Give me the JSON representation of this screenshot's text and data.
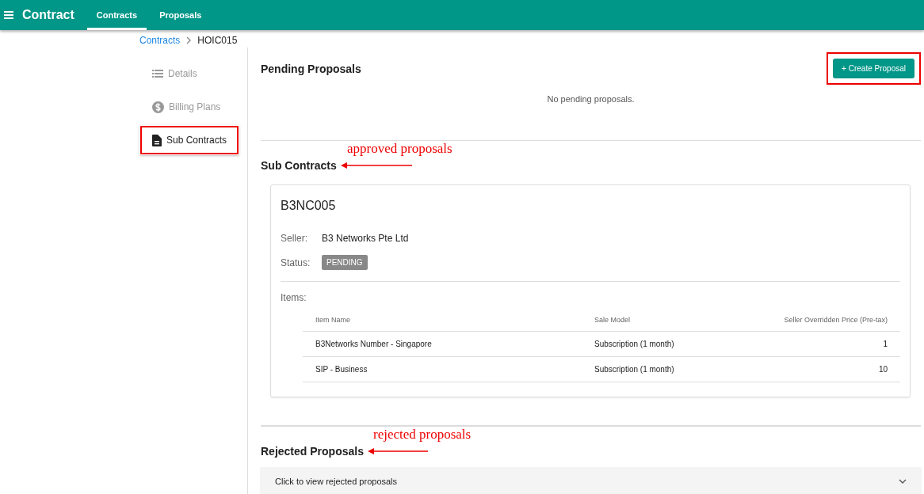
{
  "app_bar": {
    "title": "Contract",
    "tabs": [
      {
        "label": "Contracts",
        "selected": true
      },
      {
        "label": "Proposals",
        "selected": false
      }
    ]
  },
  "breadcrumb": {
    "link": "Contracts",
    "current": "HOIC015"
  },
  "sidebar": {
    "items": [
      {
        "label": "Details",
        "kind": "list",
        "selected": false,
        "highlighted": false
      },
      {
        "label": "Billing Plans",
        "kind": "dollar",
        "selected": false,
        "highlighted": false
      },
      {
        "label": "Sub Contracts",
        "kind": "document",
        "selected": true,
        "highlighted": true
      }
    ]
  },
  "pending": {
    "title": "Pending Proposals",
    "button": {
      "label": "+ Create Proposal",
      "highlighted": true
    },
    "empty_text": "No pending proposals."
  },
  "sub_contracts": {
    "title": "Sub Contracts",
    "annotation": "approved proposals",
    "cards": [
      {
        "code": "B3NC005",
        "seller_label": "Seller:",
        "seller": "B3 Networks Pte Ltd",
        "status_label": "Status:",
        "status": "PENDING",
        "items_label": "Items:",
        "columns": [
          "Item Name",
          "Sale Model",
          "Seller Overridden Price (Pre-tax)"
        ],
        "rows": [
          [
            "B3Networks Number - Singapore",
            "Subscription (1 month)",
            "1"
          ],
          [
            "SIP - Business",
            "Subscription (1 month)",
            "10"
          ]
        ]
      }
    ]
  },
  "rejected": {
    "title": "Rejected Proposals",
    "annotation": "rejected proposals",
    "expander": "Click to view rejected proposals",
    "expanded": false
  }
}
